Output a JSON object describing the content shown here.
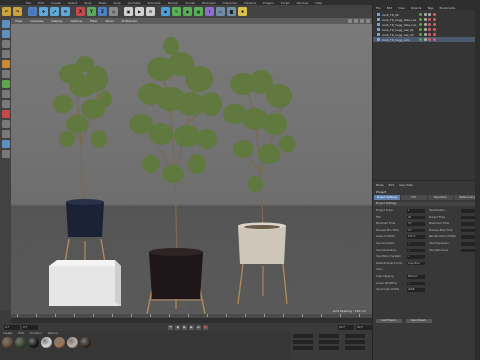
{
  "menubar": {
    "items": [
      "File",
      "Edit",
      "Create",
      "Select",
      "Tools",
      "Mesh",
      "Snap",
      "Animate",
      "Simulate",
      "Render",
      "Sculpt",
      "MoGraph",
      "Character",
      "Pipeline",
      "Plugins",
      "Script",
      "Window",
      "Help"
    ]
  },
  "toolbar": {
    "icons": [
      {
        "name": "undo-icon",
        "color": "#c9a23a",
        "glyph": "↶"
      },
      {
        "name": "redo-icon",
        "color": "#c9a23a",
        "glyph": "↷"
      },
      {
        "name": "live-selection-icon",
        "color": "#4d7fc2",
        "glyph": "⬚"
      },
      {
        "name": "move-icon",
        "color": "#5fa8d8",
        "glyph": "✥"
      },
      {
        "name": "scale-icon",
        "color": "#5fa8d8",
        "glyph": "⤢"
      },
      {
        "name": "rotate-icon",
        "color": "#5fa8d8",
        "glyph": "⟳"
      },
      {
        "name": "x-axis-icon",
        "color": "#c24a4a",
        "glyph": "X"
      },
      {
        "name": "y-axis-icon",
        "color": "#5ea85e",
        "glyph": "Y"
      },
      {
        "name": "z-axis-icon",
        "color": "#4d7fc2",
        "glyph": "Z"
      },
      {
        "name": "world-coords-icon",
        "color": "#8a8a8a",
        "glyph": "◎"
      },
      {
        "name": "render-view-icon",
        "color": "#d0d0d0",
        "glyph": "▣"
      },
      {
        "name": "render-picture-viewer-icon",
        "color": "#d0d0d0",
        "glyph": "▶"
      },
      {
        "name": "render-settings-icon",
        "color": "#d0d0d0",
        "glyph": "⚙"
      },
      {
        "name": "cube-icon",
        "color": "#4d9fd8",
        "glyph": "◆"
      },
      {
        "name": "pen-icon",
        "color": "#58b058",
        "glyph": "✎"
      },
      {
        "name": "subdivision-icon",
        "color": "#58b058",
        "glyph": "◉"
      },
      {
        "name": "array-icon",
        "color": "#58b058",
        "glyph": "▦"
      },
      {
        "name": "deformer-icon",
        "color": "#8e6cc9",
        "glyph": "⌇"
      },
      {
        "name": "floor-icon",
        "color": "#6f8ea6",
        "glyph": "▭"
      },
      {
        "name": "camera-icon",
        "color": "#6f8ea6",
        "glyph": "◙"
      },
      {
        "name": "light-icon",
        "color": "#d8c24a",
        "glyph": "✹"
      }
    ]
  },
  "lefttools": {
    "colors": [
      "#5f8fc0",
      "#5f8fc0",
      "#7a7a7a",
      "#7a7a7a",
      "#c98b3a",
      "#7a7a7a",
      "#5fa34a",
      "#7a7a7a",
      "#7a7a7a",
      "#c24a4a",
      "#7a7a7a",
      "#7a7a7a",
      "#5f8fc0",
      "#7a7a7a"
    ]
  },
  "viewport": {
    "menu": [
      "View",
      "Cameras",
      "Display",
      "Options",
      "Filter",
      "Panel",
      "ProRender"
    ],
    "status": "Grid Spacing : 100 cm"
  },
  "timeline": {
    "frame_start": "0 F",
    "frame_current": "0 F",
    "frame_end": "90 F",
    "frame_end2": "90 F"
  },
  "matmgr": {
    "menu": [
      "Create",
      "Edit",
      "Function",
      "Texture"
    ],
    "materials": [
      {
        "name": "bark-material",
        "color": "#6a5038"
      },
      {
        "name": "leaf-material",
        "color": "#3a4a2a"
      },
      {
        "name": "pot-dark-material",
        "color": "#1c1c22"
      },
      {
        "name": "pot-white-material",
        "color": "#dcdcdc"
      },
      {
        "name": "wood-material",
        "color": "#a07850"
      },
      {
        "name": "concrete-material",
        "color": "#bdb4a8"
      },
      {
        "name": "soil-material",
        "color": "#3a2e26"
      }
    ]
  },
  "objmgr": {
    "tabs": [
      "File",
      "Edit",
      "View",
      "Objects",
      "Tags",
      "Bookmarks"
    ],
    "rows": [
      {
        "label": "plant_TR_06",
        "selected": false,
        "tags": [
          "#b0b0b0",
          "#b0b0b0",
          "#d06060"
        ]
      },
      {
        "label": "plant_TR_Cegg_Olea_low_01",
        "selected": false,
        "tags": [
          "#b0b0b0",
          "#d06060",
          "#d06060"
        ]
      },
      {
        "label": "plant_TR_Cegg_Olea_low_02",
        "selected": false,
        "tags": [
          "#b0b0b0",
          "#d06060",
          "#d06060"
        ]
      },
      {
        "label": "plant_TR_Cegg_oak_01",
        "selected": false,
        "tags": [
          "#b0b0b0",
          "#d06060",
          "#d06060"
        ]
      },
      {
        "label": "plant_TR_Cegg_oak_02",
        "selected": false,
        "tags": [
          "#b0b0b0",
          "#d06060",
          "#d06060"
        ]
      },
      {
        "label": "plant_TR_Cegg_pots",
        "selected": true,
        "tags": [
          "#b0b0b0",
          "#d06060",
          "#d06060"
        ]
      }
    ]
  },
  "attrmgr": {
    "menu": [
      "Mode",
      "Edit",
      "User Data"
    ],
    "title": "Project",
    "tabs": [
      "Project Settings",
      "Info",
      "Dynamics",
      "Referencing"
    ],
    "section": "Project Settings",
    "fields": [
      {
        "label": "Project Scale",
        "value": "1",
        "extra": "Centimeters"
      },
      {
        "label": "FPS",
        "value": "30",
        "extra": "Project Time"
      },
      {
        "label": "Minimum Time",
        "value": "0 F",
        "extra": "Maximum Time"
      },
      {
        "label": "Preview Min Time",
        "value": "0 F",
        "extra": "Preview Max Time"
      },
      {
        "label": "Level of Detail",
        "value": "100 %",
        "extra": "Render LOD in Editor"
      },
      {
        "label": "Use Animation",
        "value": "✓",
        "extra": "Use Expression"
      },
      {
        "label": "Use Generators",
        "value": "✓",
        "extra": "Use Deformers"
      },
      {
        "label": "Use Motion System",
        "value": "✓",
        "extra": ""
      },
      {
        "label": "Default Object Color",
        "value": "Gray-Blue",
        "extra": ""
      },
      {
        "label": "Color",
        "value": "",
        "extra": ""
      },
      {
        "label": "View Clipping",
        "value": "Medium",
        "extra": ""
      },
      {
        "label": "Linear Workflow",
        "value": "✓",
        "extra": ""
      },
      {
        "label": "Input Color Profile",
        "value": "sRGB",
        "extra": ""
      }
    ],
    "buttons": [
      "Load Preset...",
      "Save Preset..."
    ]
  }
}
